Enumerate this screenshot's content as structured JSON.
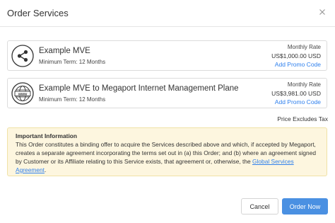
{
  "dialog": {
    "title": "Order Services",
    "close_icon": "close-icon"
  },
  "services": [
    {
      "icon": "share-nodes-icon",
      "name": "Example MVE",
      "term": "Minimum Term: 12 Months",
      "rate_label": "Monthly Rate",
      "rate_value": "US$1,000.00 USD",
      "promo_label": "Add Promo Code"
    },
    {
      "icon": "www-globe-icon",
      "name": "Example MVE to Megaport Internet Management Plane",
      "term": "Minimum Term: 12 Months",
      "rate_label": "Monthly Rate",
      "rate_value": "US$3,981.00 USD",
      "promo_label": "Add Promo Code"
    }
  ],
  "price_note": "Price Excludes Tax",
  "info": {
    "title": "Important Information",
    "body": "This Order constitutes a binding offer to acquire the Services described above and which, if accepted by Megaport, creates a separate agreement incorporating the terms set out in (a) this Order; and (b) where an agreement signed by Customer or its Affiliate relating to this Service exists, that agreement or, otherwise, the ",
    "link": "Global Services Agreement",
    "tail": "."
  },
  "buttons": {
    "cancel": "Cancel",
    "order": "Order Now"
  },
  "colors": {
    "link": "#2f80ed",
    "primary_button": "#4a90e2",
    "info_background": "#fdf6df",
    "info_border": "#f0e2a6"
  }
}
